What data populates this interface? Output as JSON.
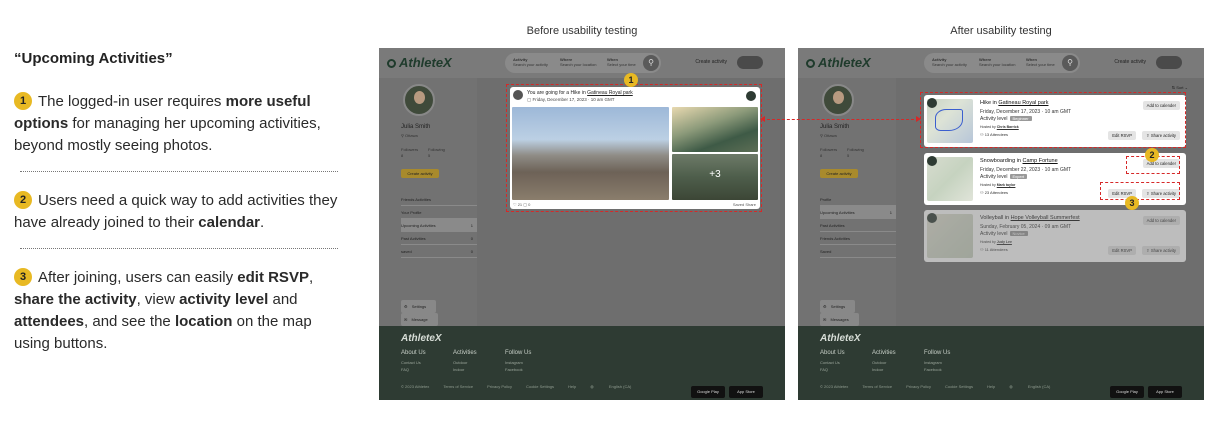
{
  "left": {
    "title": "“Upcoming Activities”",
    "points": [
      {
        "num": "1",
        "parts": [
          "The logged-in user requires ",
          "more useful options",
          " for managing her upcoming activities, beyond mostly seeing photos."
        ]
      },
      {
        "num": "2",
        "parts": [
          "Users need a quick way to add activities they have already joined to their ",
          "calendar",
          "."
        ]
      },
      {
        "num": "3",
        "parts": [
          "After joining, users can easily ",
          "edit RSVP",
          ", ",
          "share the activity",
          ", view ",
          "activity level",
          " and ",
          "attendees",
          ", and see the ",
          "location",
          " on the map using buttons."
        ]
      }
    ]
  },
  "labels": {
    "before": "Before usability testing",
    "after": "After usability testing"
  },
  "app": {
    "logo": "AthleteX",
    "search": {
      "activity_label": "Activity",
      "activity_ph": "Search your activity",
      "where_label": "Where",
      "where_ph": "Search your location",
      "when_label": "When",
      "when_ph": "Select your time"
    },
    "create_activity": "Create activity",
    "sort": "Sort",
    "profile": {
      "name": "Julia Smith",
      "location": "Ottawa",
      "followers_label": "Followers",
      "followers": "8",
      "following_label": "Following",
      "following": "5",
      "create_btn": "Create activity",
      "settings": "Settings",
      "message": "Message",
      "messages": "Messages"
    },
    "menu_before": [
      {
        "label": "Friends Activities",
        "count": ""
      },
      {
        "label": "Your Profile",
        "count": ""
      },
      {
        "label": "Upcoming Activities",
        "count": "1"
      },
      {
        "label": "Past Activities",
        "count": "0"
      },
      {
        "label": "saved",
        "count": "0"
      }
    ],
    "menu_after": [
      {
        "label": "Profile",
        "count": ""
      },
      {
        "label": "Upcoming Activities",
        "count": "1"
      },
      {
        "label": "Past Activities",
        "count": ""
      },
      {
        "label": "Friends Activities",
        "count": ""
      },
      {
        "label": "Saved",
        "count": ""
      }
    ],
    "footer": {
      "logo": "AthleteX",
      "about": "About Us",
      "contact": "Contact Us",
      "faq": "FAQ",
      "activities": "Activities",
      "outdoor": "Outdoor",
      "indoor": "Indoor",
      "follow": "Follow Us",
      "instagram": "Instagram",
      "facebook": "Facebook",
      "copyright": "© 2023 Athletex",
      "terms": "Terms of Service",
      "privacy": "Privacy Policy",
      "cookie": "Cookie Settings",
      "help": "Help",
      "lang": "English (CA)",
      "google": "Google Play",
      "apple": "App Store"
    }
  },
  "before_card": {
    "title_prefix": "You are going for a Hike in ",
    "title_place": "Gatineau Royal park",
    "date": "Friday, December 17, 2023 · 10 am GMT",
    "plus": "+3",
    "meta": "♡ 21   ▢ 0",
    "saved": "Saved   Share"
  },
  "after_cards": [
    {
      "title_prefix": "Hike in ",
      "place": "Gatineau Royal park",
      "date": "Friday, December 17, 2023 · 10 am GMT",
      "level_label": "Activity level",
      "level": "Beginner",
      "hosted_prefix": "Hosted by ",
      "host": "Chris Barrick",
      "attendees": "13 Attendees"
    },
    {
      "title_prefix": "Snowboarding in ",
      "place": "Camp Fortune",
      "date": "Friday, December 22, 2023 · 10 am GMT",
      "level_label": "Activity level",
      "level": "Expert",
      "hosted_prefix": "Hosted by ",
      "host": "Mark taylor",
      "attendees": "23 Attendees"
    },
    {
      "title_prefix": "Volleyball in ",
      "place": "Hope Volleyball Summerfest",
      "date": "Sunday, February 05, 2024 · 09 am GMT",
      "level_label": "Activity level",
      "level": "Novice",
      "hosted_prefix": "Hosted by ",
      "host": "Judy Lee",
      "attendees": "11 Attendees"
    }
  ],
  "buttons": {
    "calendar": "Add to calender",
    "rsvp": "Edit RSVP",
    "share": "Share activity"
  },
  "markers": {
    "m1": "1",
    "m2": "2",
    "m3": "3"
  }
}
